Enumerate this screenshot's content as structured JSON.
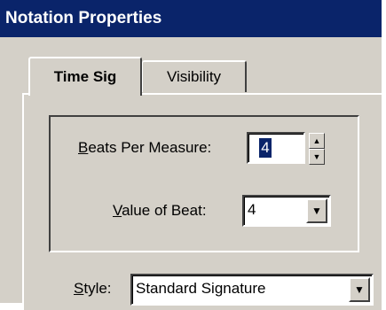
{
  "window": {
    "title": "Notation Properties"
  },
  "tabs": [
    {
      "label": "Time Sig",
      "active": true
    },
    {
      "label": "Visibility",
      "active": false
    }
  ],
  "time_sig": {
    "beats_per_measure": {
      "label_mnemonic": "B",
      "label_rest": "eats Per Measure:",
      "value": "4"
    },
    "value_of_beat": {
      "label_mnemonic": "V",
      "label_rest": "alue of Beat:",
      "value": "4"
    }
  },
  "style": {
    "label_mnemonic": "S",
    "label_rest": "tyle:",
    "value": "Standard Signature"
  },
  "icons": {
    "spin_up": "spin-up-arrow-icon",
    "spin_down": "spin-down-arrow-icon",
    "dropdown": "dropdown-arrow-icon"
  },
  "colors": {
    "title_bar": "#0a246a",
    "face": "#d4d0c8",
    "selection": "#0a246a"
  }
}
